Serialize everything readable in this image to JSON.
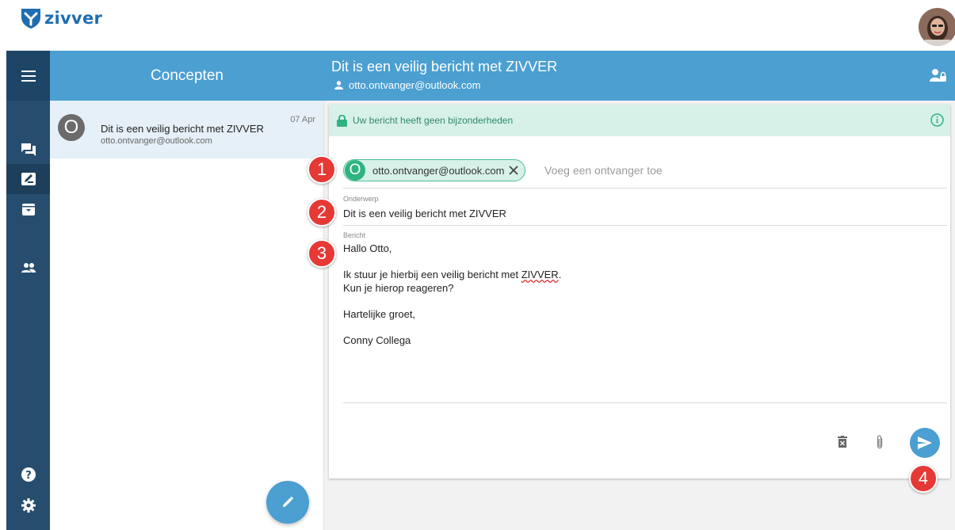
{
  "app": {
    "logo_text": "zivver"
  },
  "colors": {
    "brand_blue": "#4b9fd1",
    "rail": "#264d6e",
    "success_green": "#2fb381",
    "callout_red": "#e53935"
  },
  "nav": {
    "items": [
      {
        "name": "menu",
        "icon": "hamburger-icon"
      },
      {
        "name": "inbox",
        "icon": "chat-icon"
      },
      {
        "name": "drafts",
        "icon": "draft-icon",
        "active": true
      },
      {
        "name": "archive",
        "icon": "archive-icon"
      },
      {
        "name": "contacts",
        "icon": "people-icon"
      },
      {
        "name": "help",
        "icon": "help-icon"
      },
      {
        "name": "settings",
        "icon": "gear-icon"
      }
    ]
  },
  "list": {
    "title": "Concepten",
    "items": [
      {
        "avatar_letter": "O",
        "subject": "Dit is een veilig bericht met ZIVVER",
        "email": "otto.ontvanger@outlook.com",
        "date": "07 Apr"
      }
    ]
  },
  "message": {
    "title": "Dit is een veilig bericht met ZIVVER",
    "recipient_header": "otto.ontvanger@outlook.com",
    "banner": "Uw bericht heeft geen bijzonderheden",
    "recipient_chip": {
      "letter": "O",
      "email": "otto.ontvanger@outlook.com"
    },
    "add_recipient_placeholder": "Voeg een ontvanger toe",
    "subject_label": "Onderwerp",
    "subject": "Dit is een veilig bericht met ZIVVER",
    "body_label": "Bericht",
    "body": {
      "line1": "Hallo Otto,",
      "line2_prefix": "Ik stuur je hierbij een veilig bericht met ",
      "line2_word": "ZIVVER",
      "line2_suffix": ".",
      "line3": "Kun je hierop reageren?",
      "line4": "Hartelijke groet,",
      "line5": "Conny Collega"
    }
  },
  "callouts": {
    "c1": "1",
    "c2": "2",
    "c3": "3",
    "c4": "4"
  }
}
